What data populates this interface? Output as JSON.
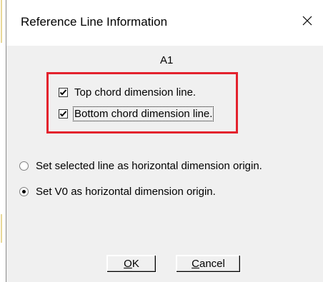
{
  "dialog": {
    "title": "Reference Line Information",
    "close_icon": "close-icon"
  },
  "panel": {
    "label": "A1"
  },
  "checkboxes": [
    {
      "label": "Top chord dimension line.",
      "checked": true
    },
    {
      "label": "Bottom chord dimension line.",
      "checked": true
    }
  ],
  "radios": [
    {
      "label": "Set selected line as horizontal dimension origin.",
      "selected": false
    },
    {
      "label": "Set V0 as horizontal dimension origin.",
      "selected": true
    }
  ],
  "buttons": {
    "ok": {
      "mnemonic": "O",
      "rest": "K"
    },
    "cancel": {
      "mnemonic": "C",
      "rest": "ancel"
    }
  },
  "colors": {
    "highlight_box": "#e3222d",
    "dialog_bg": "#f0f0f0"
  }
}
